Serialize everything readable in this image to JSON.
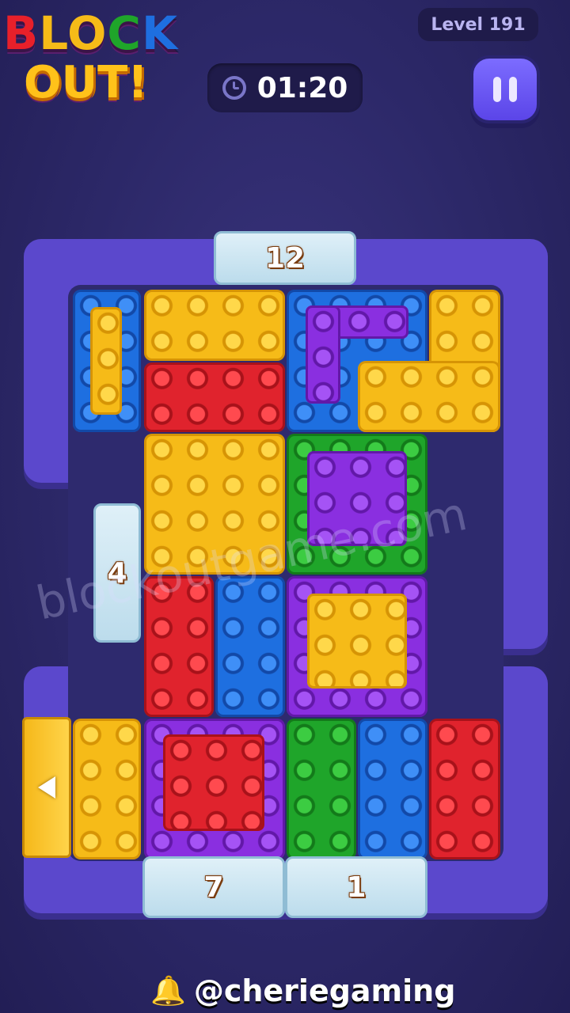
{
  "logo": {
    "line1": [
      "B",
      "L",
      "O",
      "C",
      "K"
    ],
    "line2": "OUT!",
    "line1_colors": [
      "#e8202a",
      "#f6bb18",
      "#f6bb18",
      "#1fa52a",
      "#1e6fe0"
    ]
  },
  "header": {
    "timer": "01:20",
    "level": "Level 191"
  },
  "icons": {
    "clock": "clock-icon",
    "pause": "pause-icon",
    "exit": "arrow-left-icon",
    "bell": "bell-icon"
  },
  "gates": {
    "top": "12",
    "left": "4",
    "bottom_left": "7",
    "bottom_right": "1"
  },
  "watermark": "blockoutgame.com",
  "credit": {
    "bell": "🔔",
    "handle": "@cheriegaming"
  },
  "colors": {
    "yellow": "#f6bb18",
    "red": "#e0232d",
    "blue": "#1e6fe0",
    "green": "#1fa52a",
    "purple": "#8a2fe0",
    "board": "#5b48cc"
  }
}
